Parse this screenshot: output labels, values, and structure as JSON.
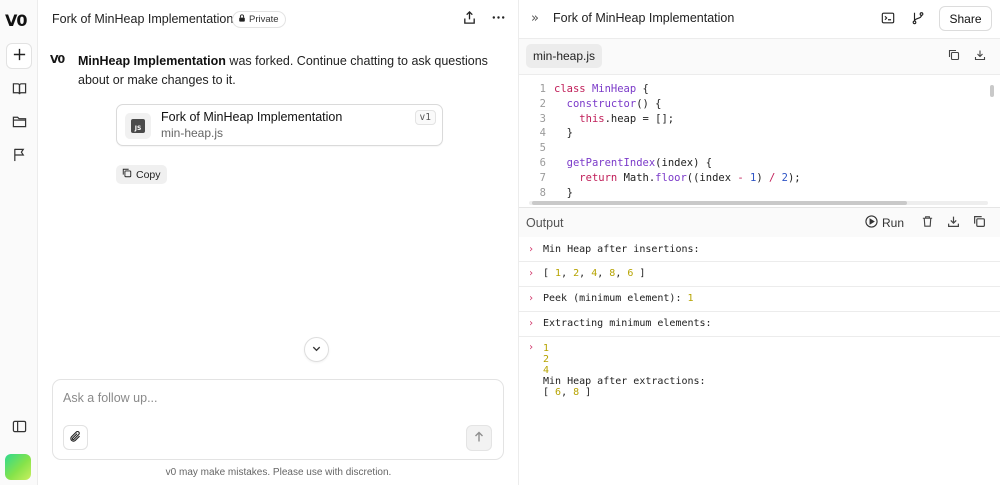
{
  "app": {
    "logo": "V0"
  },
  "sidebar": {
    "items": [
      {
        "name": "new-chat",
        "icon": "plus-icon"
      },
      {
        "name": "library",
        "icon": "book-icon"
      },
      {
        "name": "projects",
        "icon": "folder-icon"
      },
      {
        "name": "feedback",
        "icon": "flag-icon"
      },
      {
        "name": "toggle-sidebar",
        "icon": "sidebar-icon"
      }
    ]
  },
  "chat": {
    "title": "Fork of MinHeap Implementation",
    "privacy": "Private",
    "message": {
      "bold": "MinHeap Implementation",
      "rest": " was forked. Continue chatting to ask questions about or make changes to it."
    },
    "file_card": {
      "name": "Fork of MinHeap Implementation",
      "file": "min-heap.js",
      "version": "v1",
      "icon_label": "JS"
    },
    "copy_label": "Copy",
    "composer": {
      "placeholder": "Ask a follow up..."
    },
    "disclaimer": "v0 may make mistakes. Please use with discretion."
  },
  "preview": {
    "title": "Fork of MinHeap Implementation",
    "share_label": "Share",
    "file_tab": "min-heap.js",
    "code_lines": [
      {
        "n": "1",
        "tokens": [
          [
            "kw",
            "class "
          ],
          [
            "cls",
            "MinHeap"
          ],
          [
            "txt",
            " {"
          ]
        ]
      },
      {
        "n": "2",
        "tokens": [
          [
            "txt",
            "  "
          ],
          [
            "fn",
            "constructor"
          ],
          [
            "txt",
            "() {"
          ]
        ]
      },
      {
        "n": "3",
        "tokens": [
          [
            "txt",
            "    "
          ],
          [
            "kw",
            "this"
          ],
          [
            "txt",
            ".heap = [];"
          ]
        ]
      },
      {
        "n": "4",
        "tokens": [
          [
            "txt",
            "  }"
          ]
        ]
      },
      {
        "n": "5",
        "tokens": []
      },
      {
        "n": "6",
        "tokens": [
          [
            "txt",
            "  "
          ],
          [
            "fn",
            "getParentIndex"
          ],
          [
            "txt",
            "(index) {"
          ]
        ]
      },
      {
        "n": "7",
        "tokens": [
          [
            "txt",
            "    "
          ],
          [
            "kw",
            "return "
          ],
          [
            "txt",
            "Math."
          ],
          [
            "fn",
            "floor"
          ],
          [
            "txt",
            "((index "
          ],
          [
            "kw",
            "-"
          ],
          [
            "txt",
            " "
          ],
          [
            "num",
            "1"
          ],
          [
            "txt",
            ") "
          ],
          [
            "kw",
            "/"
          ],
          [
            "txt",
            " "
          ],
          [
            "num",
            "2"
          ],
          [
            "txt",
            ");"
          ]
        ]
      },
      {
        "n": "8",
        "tokens": [
          [
            "txt",
            "  }"
          ]
        ]
      }
    ],
    "output": {
      "label": "Output",
      "run_label": "Run",
      "rows": [
        {
          "segments": [
            [
              "txt",
              "Min Heap after insertions:"
            ]
          ]
        },
        {
          "segments": [
            [
              "txt",
              "[ "
            ],
            [
              "y",
              "1"
            ],
            [
              "txt",
              ", "
            ],
            [
              "y",
              "2"
            ],
            [
              "txt",
              ", "
            ],
            [
              "y",
              "4"
            ],
            [
              "txt",
              ", "
            ],
            [
              "y",
              "8"
            ],
            [
              "txt",
              ", "
            ],
            [
              "y",
              "6"
            ],
            [
              "txt",
              " ]"
            ]
          ]
        },
        {
          "segments": [
            [
              "txt",
              "Peek (minimum element): "
            ],
            [
              "y",
              "1"
            ]
          ]
        },
        {
          "segments": [
            [
              "txt",
              "Extracting minimum elements:"
            ]
          ]
        }
      ],
      "final_block": [
        [
          [
            "y",
            "1"
          ]
        ],
        [
          [
            "y",
            "2"
          ]
        ],
        [
          [
            "y",
            "4"
          ]
        ],
        [
          [
            "txt",
            "Min Heap after extractions:"
          ]
        ],
        [
          [
            "txt",
            "[ "
          ],
          [
            "y",
            "6"
          ],
          [
            "txt",
            ", "
          ],
          [
            "y",
            "8"
          ],
          [
            "txt",
            " ]"
          ]
        ]
      ]
    }
  }
}
